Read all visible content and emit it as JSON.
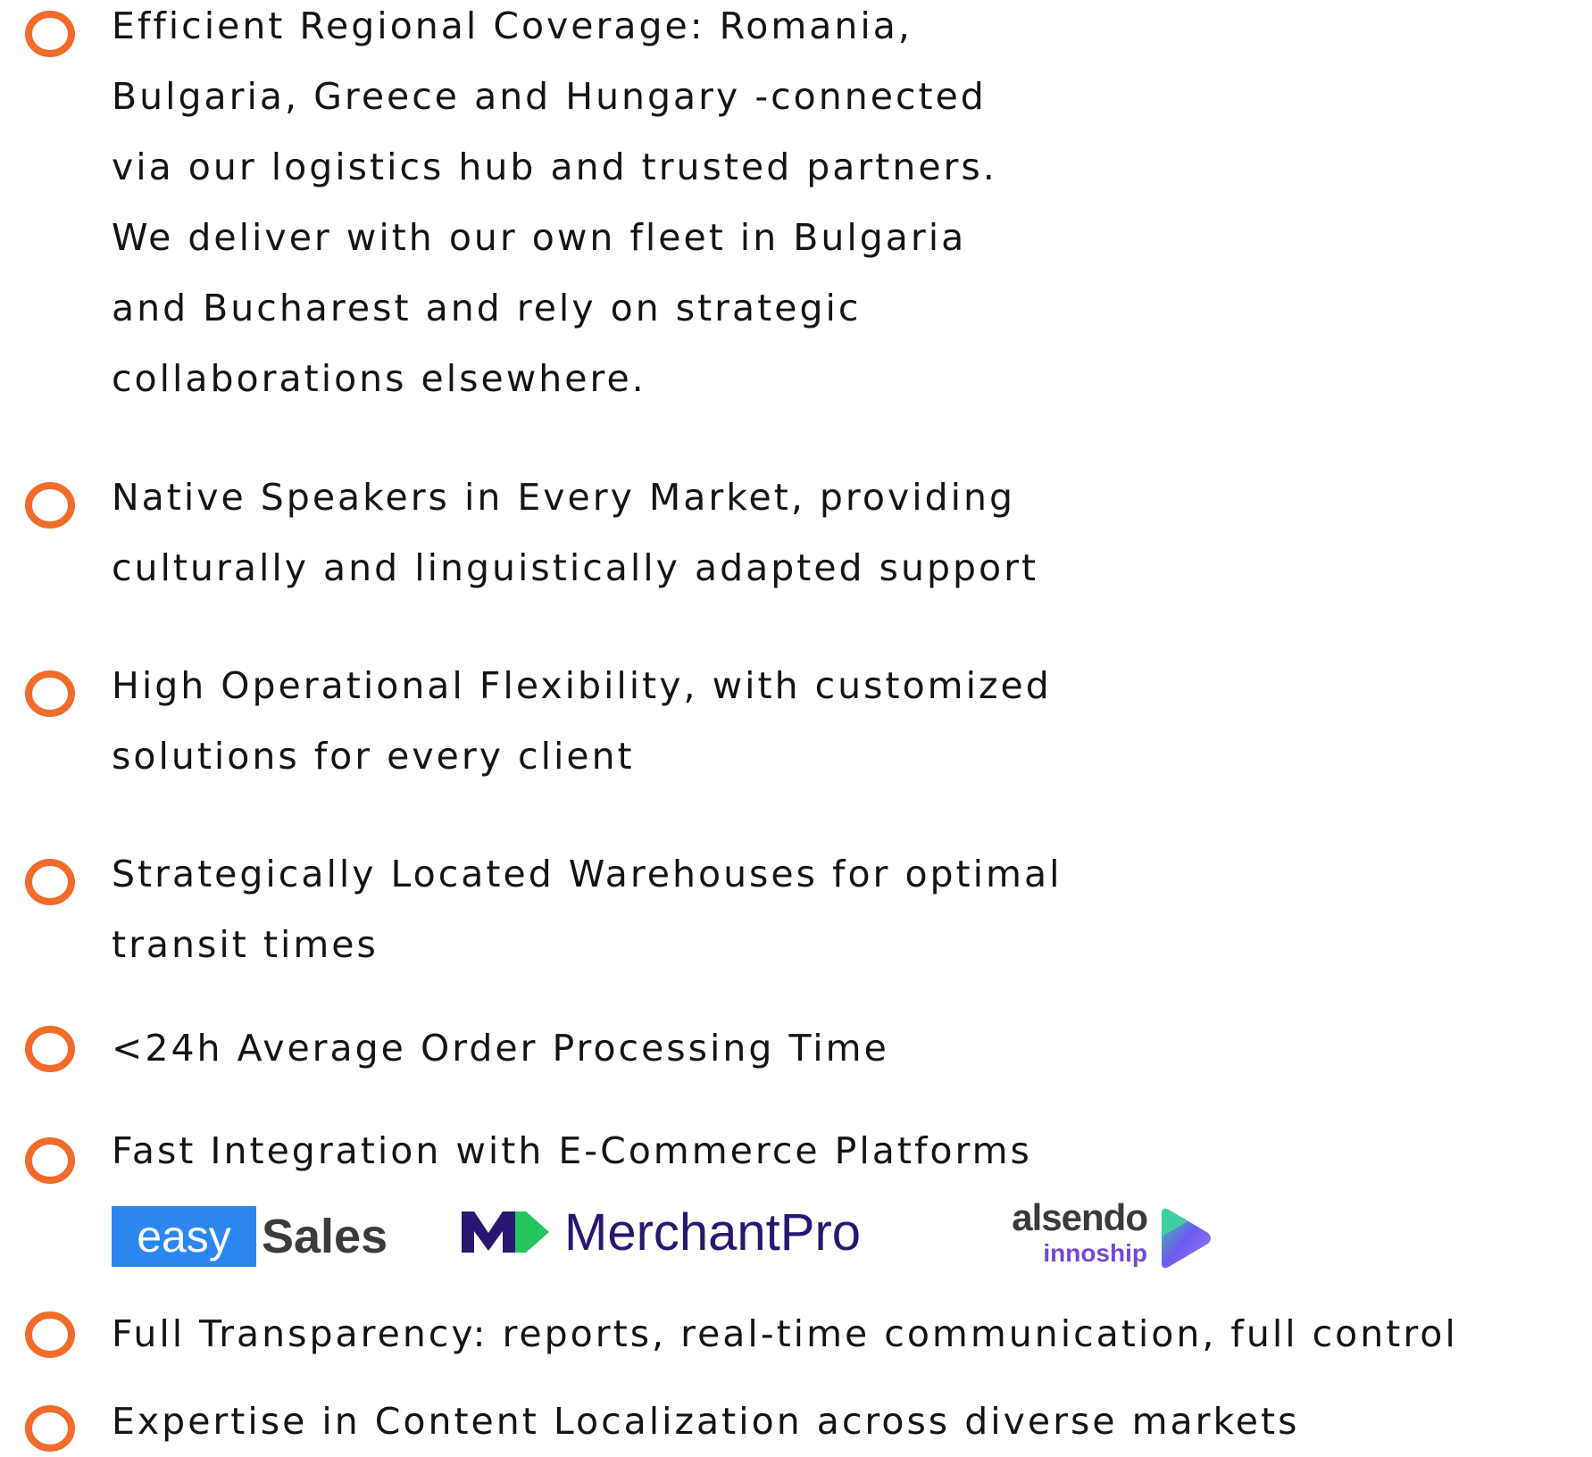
{
  "colors": {
    "bullet": "#f26b2b",
    "text": "#141414",
    "easy_blue": "#2b86f0",
    "merchantpro_navy": "#2a1570",
    "merchantpro_green": "#22c55e",
    "innoship_purple": "#7248d8"
  },
  "items": [
    {
      "icon": "ring-bullet-icon",
      "text": "Efficient Regional Coverage: Romania,\nBulgaria, Greece and Hungary -connected\nvia our logistics hub and trusted partners.\nWe deliver with our own fleet in Bulgaria\nand Bucharest and rely on strategic\ncollaborations elsewhere."
    },
    {
      "icon": "ring-bullet-icon",
      "text": "Native Speakers in Every Market, providing\nculturally and linguistically adapted support"
    },
    {
      "icon": "ring-bullet-icon",
      "text": "High Operational Flexibility, with customized\nsolutions for every client"
    },
    {
      "icon": "ring-bullet-icon",
      "text": "Strategically Located Warehouses for optimal\ntransit times"
    },
    {
      "icon": "ring-bullet-icon",
      "text": "<24h Average Order Processing Time"
    },
    {
      "icon": "ring-bullet-icon",
      "text": "Fast Integration with E-Commerce Platforms"
    },
    {
      "icon": "ring-bullet-icon",
      "text": "Full Transparency: reports, real-time communication, full control"
    },
    {
      "icon": "ring-bullet-icon",
      "text": "Expertise in Content Localization across diverse markets"
    }
  ],
  "logos": {
    "easysales": {
      "part1": "easy",
      "part2": "Sales"
    },
    "merchantpro": {
      "name": "MerchantPro"
    },
    "alsendo": {
      "name": "alsendo",
      "sub": "innoship"
    }
  }
}
